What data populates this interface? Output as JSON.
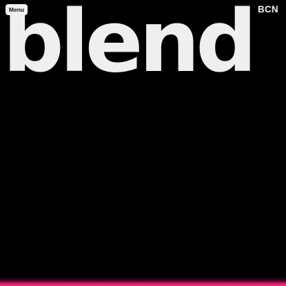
{
  "header": {
    "menu_label": "Menu",
    "logo_text": "blend",
    "city": "BCN"
  },
  "colors": {
    "background": "#000000",
    "logo": "#efefef",
    "accent_glow": "#f32d7c"
  }
}
